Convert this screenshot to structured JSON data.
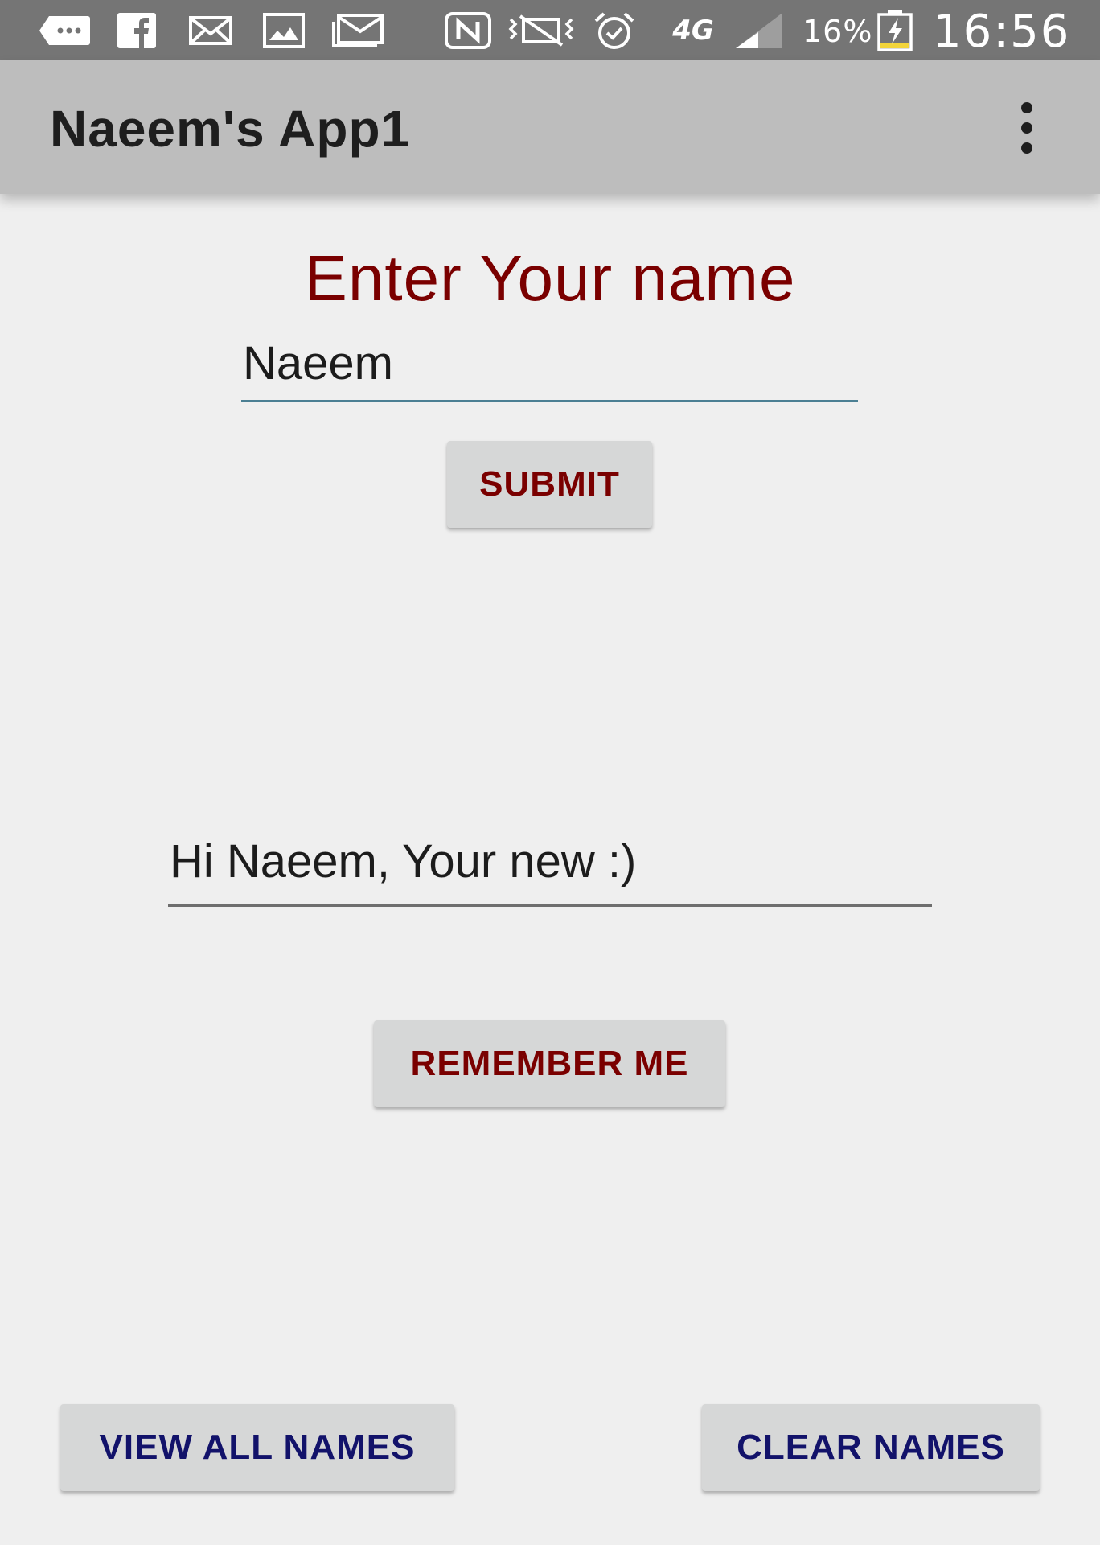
{
  "status_bar": {
    "notification_icons": [
      "chat-bubble-icon",
      "facebook-icon",
      "mail-icon",
      "gallery-icon",
      "gmail-icon"
    ],
    "system_icons": [
      "nfc-icon",
      "vibrate-icon",
      "alarm-icon",
      "network-4g-icon",
      "signal-icon"
    ],
    "network_type": "4G",
    "battery_percent": "16%",
    "battery_icon": "battery-charging-icon",
    "time": "16:56"
  },
  "app_bar": {
    "title": "Naeem's App1",
    "menu_icon": "overflow-menu-icon"
  },
  "form": {
    "prompt": "Enter Your name",
    "name_value": "Naeem",
    "submit_label": "SUBMIT"
  },
  "result": {
    "greeting": "Hi Naeem, Your new :)",
    "remember_label": "REMEMBER ME"
  },
  "footer": {
    "view_all_label": "VIEW ALL NAMES",
    "clear_label": "CLEAR NAMES"
  },
  "colors": {
    "status_bar_bg": "#757575",
    "app_bar_bg": "#bdbdbd",
    "background": "#efefef",
    "accent_red": "#7a0000",
    "accent_navy": "#12126a",
    "button_bg": "#d6d7d7",
    "input_underline": "#4b7f93"
  }
}
